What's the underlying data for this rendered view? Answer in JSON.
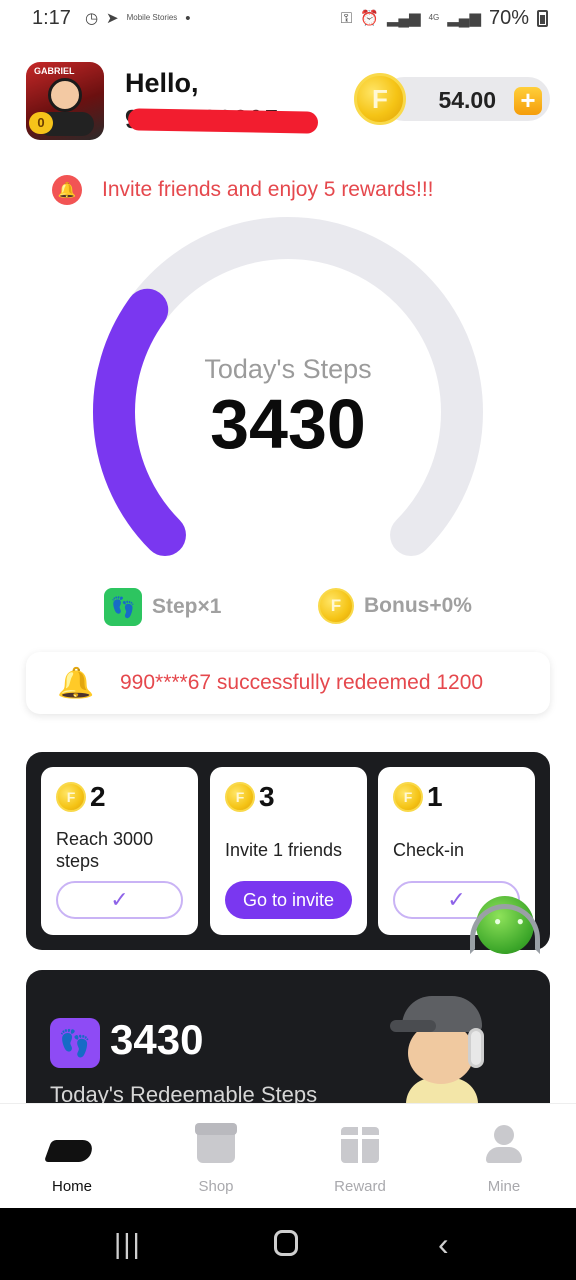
{
  "status_bar": {
    "time": "1:17",
    "battery": "70%",
    "network": "4G",
    "notif_tiny_text": "Mobile Stories"
  },
  "header": {
    "greeting": "Hello,",
    "phone_masked": "9277363305",
    "avatar_tag": "GABRIEL",
    "avatar_level": "0",
    "coin_symbol": "F",
    "coin_balance": "54.00",
    "add_label": "+"
  },
  "invite_banner": {
    "icon": "bell-icon",
    "text": "Invite friends and enjoy 5 rewards!!!"
  },
  "steps_gauge": {
    "label": "Today's Steps",
    "value": "3430",
    "progress_fraction": 0.3,
    "progress_color": "#7a37f0",
    "track_color": "#e9e9ee"
  },
  "multipliers": {
    "step_label": "Step×1",
    "bonus_label": "Bonus+0%"
  },
  "ticker": {
    "text": "990****67 successfully redeemed 1200"
  },
  "tasks": [
    {
      "reward": "2",
      "title": "Reach 3000 steps",
      "button": "✓",
      "state": "done"
    },
    {
      "reward": "3",
      "title": "Invite 1 friends",
      "button": "Go to invite",
      "state": "go"
    },
    {
      "reward": "1",
      "title": "Check-in",
      "button": "✓",
      "state": "done"
    }
  ],
  "redeem": {
    "value": "3430",
    "label": "Today's Redeemable Steps"
  },
  "bottom_nav": [
    {
      "label": "Home",
      "active": true
    },
    {
      "label": "Shop",
      "active": false
    },
    {
      "label": "Reward",
      "active": false
    },
    {
      "label": "Mine",
      "active": false
    }
  ],
  "colors": {
    "accent": "#7a37f0",
    "alert_red": "#e5484d",
    "gold": "#f5c416",
    "dark_panel": "#1b1c1f"
  }
}
